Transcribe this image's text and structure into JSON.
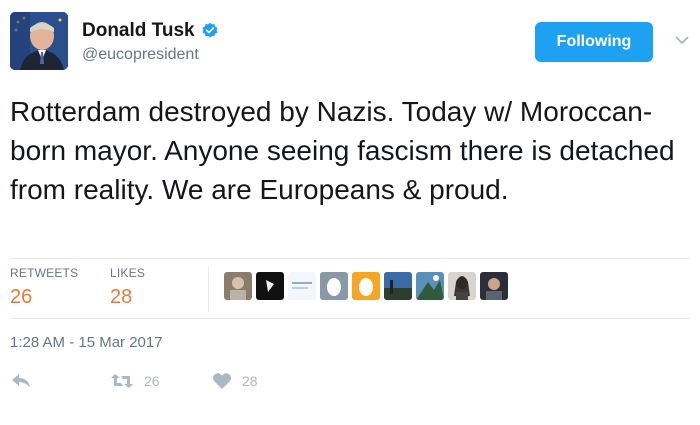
{
  "user": {
    "display_name": "Donald Tusk",
    "handle": "@eucopresident",
    "verified_icon": "verified-badge-icon",
    "avatar_icon": "profile-photo"
  },
  "follow_button": {
    "label": "Following"
  },
  "menu": {
    "icon": "chevron-down-icon"
  },
  "tweet": {
    "text": "Rotterdam destroyed by Nazis. Today w/ Moroccan-born mayor. Anyone seeing fascism there is detached from reality. We are Europeans & proud."
  },
  "stats": {
    "retweets_label": "RETWEETS",
    "retweets_value": "26",
    "likes_label": "LIKES",
    "likes_value": "28"
  },
  "likers": {
    "avatar_icons": [
      "liker-avatar-1",
      "liker-avatar-2",
      "liker-avatar-3",
      "liker-avatar-4",
      "liker-avatar-5",
      "liker-avatar-6",
      "liker-avatar-7",
      "liker-avatar-8",
      "liker-avatar-9",
      "liker-avatar-10"
    ]
  },
  "timestamp": "1:28 AM - 15 Mar 2017",
  "actions": {
    "reply_icon": "reply-icon",
    "retweet_icon": "retweet-icon",
    "retweet_count": "26",
    "like_icon": "heart-icon",
    "like_count": "28"
  },
  "colors": {
    "accent": "#1da1f2",
    "stat_value": "#e07b39",
    "muted": "#657786",
    "action_gray": "#aab8c2"
  }
}
